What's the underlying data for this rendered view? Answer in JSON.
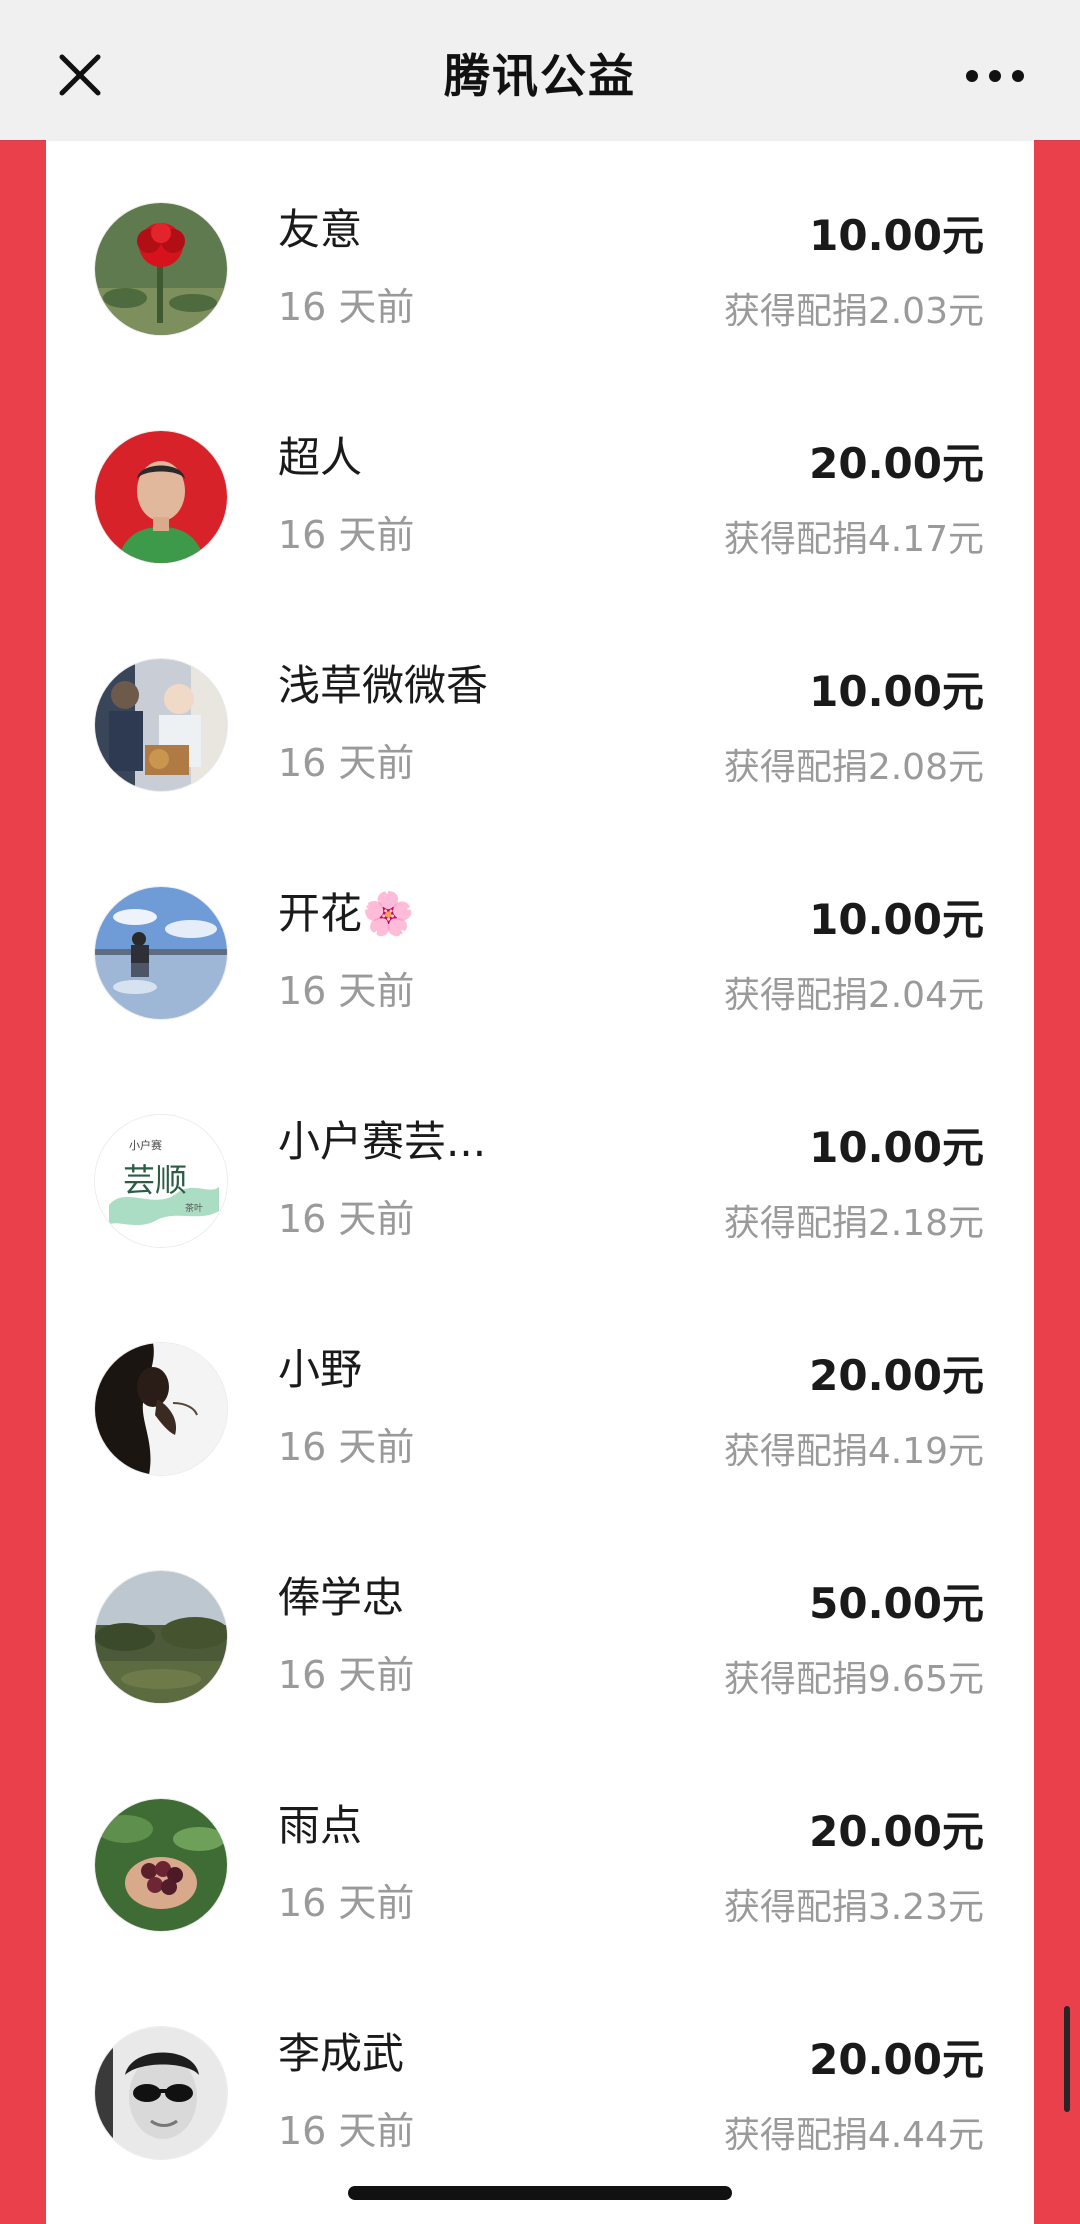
{
  "header": {
    "title": "腾讯公益",
    "close_icon": "close-icon",
    "more_icon": "more-icon"
  },
  "donations": [
    {
      "name": "友意",
      "time": "16 天前",
      "amount": "10.00元",
      "match": "获得配捐2.03元",
      "avatar_icon": "red-flower-avatar"
    },
    {
      "name": "超人",
      "time": "16 天前",
      "amount": "20.00元",
      "match": "获得配捐4.17元",
      "avatar_icon": "portrait-red-background-avatar"
    },
    {
      "name": "浅草微微香",
      "time": "16 天前",
      "amount": "10.00元",
      "match": "获得配捐2.08元",
      "avatar_icon": "group-photo-avatar"
    },
    {
      "name": "开花🌸",
      "time": "16 天前",
      "amount": "10.00元",
      "match": "获得配捐2.04元",
      "avatar_icon": "lake-sky-avatar"
    },
    {
      "name": "小户赛芸...",
      "time": "16 天前",
      "amount": "10.00元",
      "match": "获得配捐2.18元",
      "avatar_icon": "tea-logo-avatar",
      "avatar_text": {
        "top": "小户赛",
        "main": "芸顺",
        "bottom": "茶叶"
      }
    },
    {
      "name": "小野",
      "time": "16 天前",
      "amount": "20.00元",
      "match": "获得配捐4.19元",
      "avatar_icon": "silhouette-avatar"
    },
    {
      "name": "俸学忠",
      "time": "16 天前",
      "amount": "50.00元",
      "match": "获得配捐9.65元",
      "avatar_icon": "landscape-avatar"
    },
    {
      "name": "雨点",
      "time": "16 天前",
      "amount": "20.00元",
      "match": "获得配捐3.23元",
      "avatar_icon": "coffee-cherries-avatar"
    },
    {
      "name": "李成武",
      "time": "16 天前",
      "amount": "20.00元",
      "match": "获得配捐4.44元",
      "avatar_icon": "sunglasses-portrait-avatar"
    }
  ],
  "colors": {
    "page_background": "#e9404c",
    "top_bar": "#f0f0f0",
    "card": "#ffffff",
    "primary_text": "#1a1a1a",
    "secondary_text": "#9a9a9a"
  }
}
